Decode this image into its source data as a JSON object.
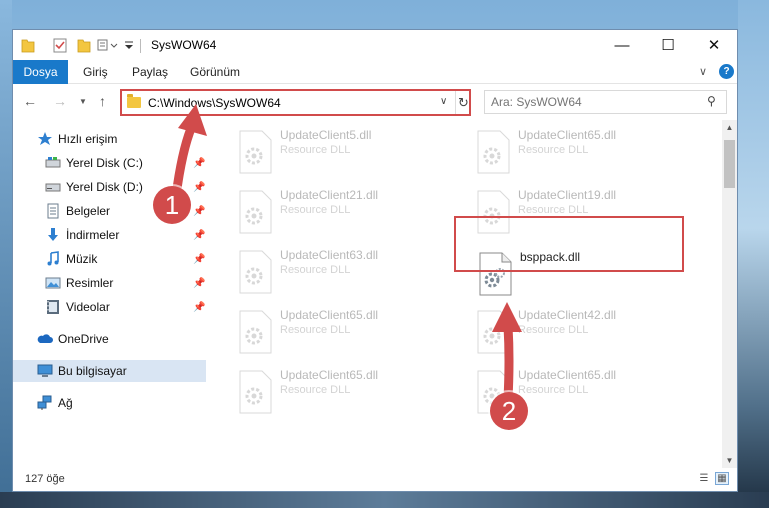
{
  "window": {
    "title": "SysWOW64",
    "minimize_glyph": "—",
    "maximize_glyph": "☐",
    "close_glyph": "✕"
  },
  "ribbon": {
    "tabs": [
      "Dosya",
      "Giriş",
      "Paylaş",
      "Görünüm"
    ],
    "file_color": "#1979ca"
  },
  "address": {
    "path": "C:\\Windows\\SysWOW64"
  },
  "search": {
    "placeholder": "Ara: SysWOW64"
  },
  "sidebar": {
    "items": [
      {
        "label": "Hızlı erişim",
        "icon": "star-icon"
      },
      {
        "label": "Yerel Disk (C:)",
        "icon": "drive-icon"
      },
      {
        "label": "Yerel Disk (D:)",
        "icon": "drive-icon"
      },
      {
        "label": "Belgeler",
        "icon": "documents-icon"
      },
      {
        "label": "İndirmeler",
        "icon": "download-icon"
      },
      {
        "label": "Müzik",
        "icon": "music-icon"
      },
      {
        "label": "Resimler",
        "icon": "pictures-icon"
      },
      {
        "label": "Videolar",
        "icon": "videos-icon"
      },
      {
        "label": "OneDrive",
        "icon": "cloud-icon"
      },
      {
        "label": "Bu bilgisayar",
        "icon": "computer-icon"
      },
      {
        "label": "Ağ",
        "icon": "network-icon"
      }
    ]
  },
  "files": [
    {
      "name": "UpdateClient5.dll",
      "type": "Resource DLL"
    },
    {
      "name": "UpdateClient65.dll",
      "type": "Resource DLL"
    },
    {
      "name": "UpdateClient21.dll",
      "type": "Resource DLL"
    },
    {
      "name": "UpdateClient19.dll",
      "type": "Resource DLL"
    },
    {
      "name": "UpdateClient63.dll",
      "type": "Resource DLL"
    },
    {
      "name": "bsppack.dll",
      "type": ""
    },
    {
      "name": "UpdateClient65.dll",
      "type": "Resource DLL"
    },
    {
      "name": "UpdateClient42.dll",
      "type": "Resource DLL"
    },
    {
      "name": "UpdateClient65.dll",
      "type": "Resource DLL"
    },
    {
      "name": "UpdateClient65.dll",
      "type": "Resource DLL"
    }
  ],
  "status": {
    "count": "127 öğe"
  },
  "annotations": {
    "step1": "1",
    "step2": "2",
    "color": "#d14b4b"
  }
}
